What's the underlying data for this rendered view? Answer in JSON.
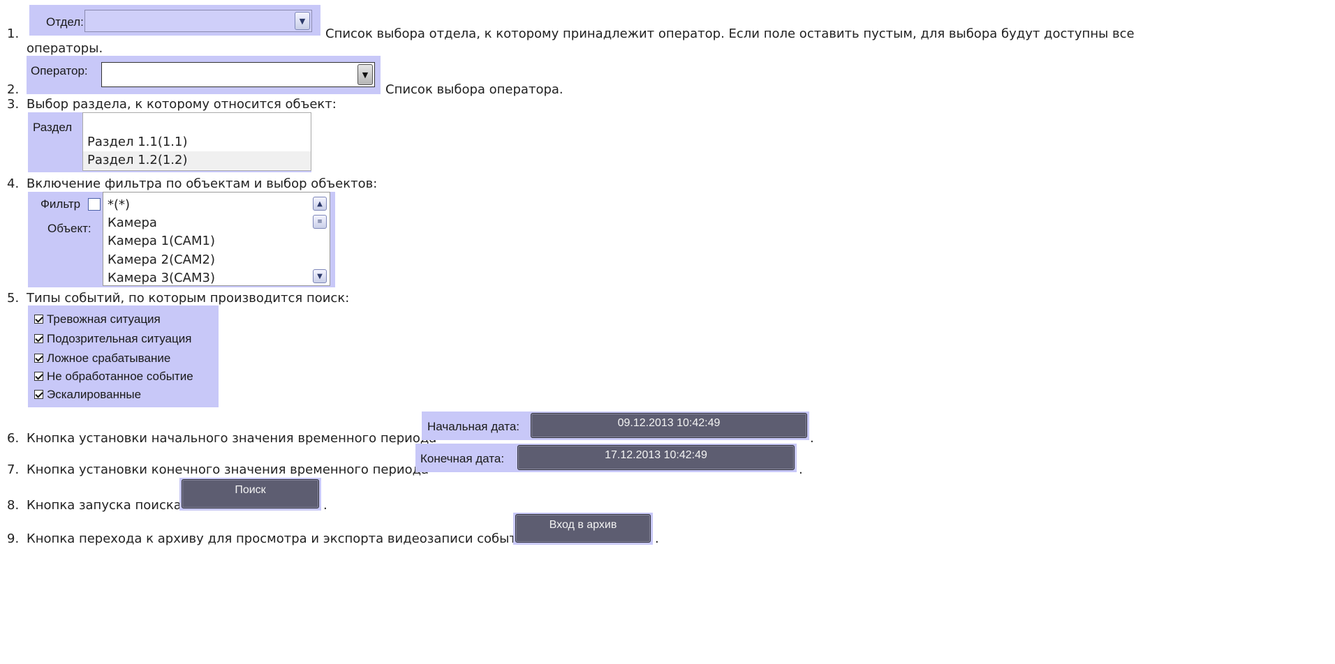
{
  "items": [
    {
      "num": "1.",
      "text": "Список выбора отдела, к которому принадлежит оператор. Если поле оставить пустым, для выбора будут доступны все",
      "text2": "операторы."
    },
    {
      "num": "2.",
      "text": "Список выбора оператора."
    },
    {
      "num": "3.",
      "text": "Выбор раздела, к которому относится объект:"
    },
    {
      "num": "4.",
      "text": "Включение фильтра по объектам и выбор объектов:"
    },
    {
      "num": "5.",
      "text": "Типы событий, по которым производится поиск:"
    },
    {
      "num": "6.",
      "text": "Кнопка установки начального значения временного периода",
      "suffix": "."
    },
    {
      "num": "7.",
      "text": "Кнопка установки конечного значения временного периода",
      "suffix": "."
    },
    {
      "num": "8.",
      "text": "Кнопка запуска поиска",
      "suffix": "."
    },
    {
      "num": "9.",
      "text": "Кнопка перехода к архиву для просмотра и экспорта видеозаписи события",
      "suffix": "."
    }
  ],
  "department": {
    "label": "Отдел:",
    "value": ""
  },
  "operator": {
    "label": "Оператор:",
    "value": ""
  },
  "section": {
    "label": "Раздел",
    "options": [
      "Раздел 1.1(1.1)",
      "Раздел 1.2(1.2)"
    ]
  },
  "objects": {
    "filter_label": "Фильтр",
    "filter_checked": false,
    "label": "Объект:",
    "options": [
      "*(*)",
      "Камера",
      "Камера 1(CAM1)",
      "Камера 2(CAM2)",
      "Камера 3(CAM3)"
    ]
  },
  "events": [
    {
      "label": "Тревожная ситуация",
      "checked": true
    },
    {
      "label": "Подозрительная ситуация",
      "checked": true
    },
    {
      "label": "Ложное срабатывание",
      "checked": true
    },
    {
      "label": "Не обработанное событие",
      "checked": true
    },
    {
      "label": "Эскалированные",
      "checked": true
    }
  ],
  "start_date": {
    "label": "Начальная дата:",
    "value": "09.12.2013 10:42:49"
  },
  "end_date": {
    "label": "Конечная дата:",
    "value": "17.12.2013 10:42:49"
  },
  "search_button": "Поиск",
  "archive_button": "Вход в архив",
  "colors": {
    "panel": "#c8c8f8",
    "dark_button": "#5d5d71"
  }
}
